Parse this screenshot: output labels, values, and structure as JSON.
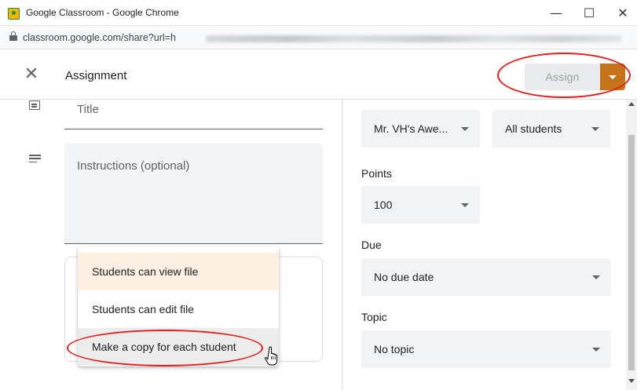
{
  "window": {
    "title": "Google Classroom - Google Chrome",
    "controls": {
      "minimize": "—",
      "maximize": "☐",
      "close": "✕"
    },
    "url": "classroom.google.com/share?url=h"
  },
  "header": {
    "close_icon": "✕",
    "title": "Assignment",
    "assign_label": "Assign"
  },
  "form": {
    "title_placeholder": "Title",
    "instructions_placeholder": "Instructions (optional)"
  },
  "share_menu": {
    "items": [
      {
        "label": "Students can view file",
        "state": "selected"
      },
      {
        "label": "Students can edit file",
        "state": "normal"
      },
      {
        "label": "Make a copy for each student",
        "state": "hover"
      }
    ]
  },
  "settings": {
    "class_value": "Mr. VH's Awe...",
    "students_value": "All students",
    "points_label": "Points",
    "points_value": "100",
    "due_label": "Due",
    "due_value": "No due date",
    "topic_label": "Topic",
    "topic_value": "No topic"
  },
  "colors": {
    "assign_dropdown": "#c5731a",
    "selected_menu_item": "#fdefe2",
    "annotation": "#e0201c"
  }
}
